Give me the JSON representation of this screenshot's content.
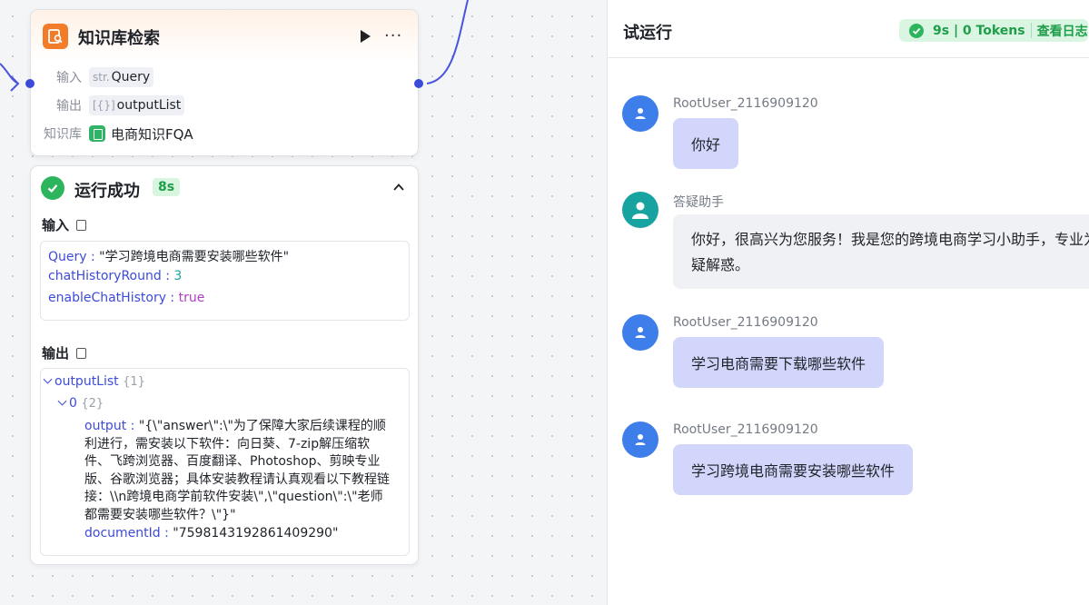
{
  "node": {
    "title": "知识库检索",
    "input_label": "输入",
    "input_type": "str.",
    "input_value": "Query",
    "output_label": "输出",
    "output_type": "[{}]",
    "output_value": "outputList",
    "kb_label": "知识库",
    "kb_value": "电商知识FQA"
  },
  "result": {
    "title": "运行成功",
    "time": "8s",
    "input_title": "输入",
    "inputs": [
      {
        "key": "Query",
        "value": "\"学习跨境电商需要安装哪些软件\""
      },
      {
        "key": "chatHistoryRound",
        "value": "3"
      },
      {
        "key": "enableChatHistory",
        "value": "true"
      }
    ],
    "output_title": "输出",
    "tree_root": "outputList",
    "tree_root_count": "{1}",
    "tree_item": "0",
    "tree_item_count": "{2}",
    "output_key": "output",
    "output_value": "\"{\\\"answer\\\":\\\"为了保障大家后续课程的顺利进行，需安装以下软件：向日葵、7-zip解压缩软件、飞跨浏览器、百度翻译、Photoshop、剪映专业版、谷歌浏览器；具体安装教程请认真观看以下教程链接：\\\\n跨境电商学前软件安装\\\",\\\"question\\\":\\\"老师都需要安装哪些软件？\\\"}\"",
    "doc_key": "documentId",
    "doc_value": "\"7598143192861409290\""
  },
  "panel": {
    "title": "试运行",
    "status_time": "9s | 0 Tokens",
    "status_log": "查看日志",
    "messages": [
      {
        "role": "user",
        "name": "RootUser_2116909120",
        "text": "你好"
      },
      {
        "role": "bot",
        "name": "答疑助手",
        "text": "你好，很高兴为您服务！我是您的跨境电商学习小助手，专业为您答疑解惑。"
      },
      {
        "role": "user",
        "name": "RootUser_2116909120",
        "text": "学习电商需要下载哪些软件"
      },
      {
        "role": "user",
        "name": "RootUser_2116909120",
        "text": "学习跨境电商需要安装哪些软件"
      }
    ]
  },
  "colors": {
    "accent": "#3b4bd8",
    "success": "#2db55d",
    "node_icon": "#f27c2a",
    "user_bubble": "#d2d6fb"
  }
}
